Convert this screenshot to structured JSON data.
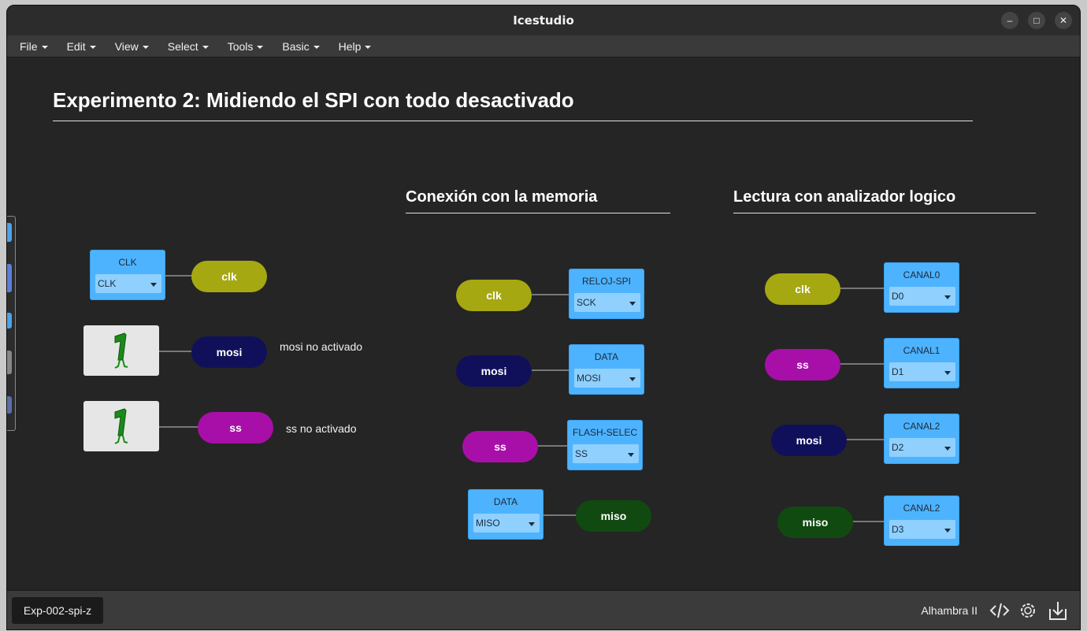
{
  "window": {
    "title": "Icestudio"
  },
  "window_controls": {
    "minimize": "–",
    "maximize": "□",
    "close": "✕"
  },
  "menu": [
    "File",
    "Edit",
    "View",
    "Select",
    "Tools",
    "Basic",
    "Help"
  ],
  "canvas": {
    "main_title": "Experimento 2: Midiendo el SPI con todo desactivado",
    "section_memory": "Conexión con la memoria",
    "section_analyzer": "Lectura con analizador logico",
    "left": {
      "clk_block": {
        "label": "CLK",
        "value": "CLK"
      },
      "clk_pill": "clk",
      "mosi_pill": "mosi",
      "ss_pill": "ss",
      "mosi_note": "mosi no activado",
      "ss_note": "ss no activado"
    },
    "memory": {
      "clk_pill": "clk",
      "mosi_pill": "mosi",
      "ss_pill": "ss",
      "miso_pill": "miso",
      "reloj_block": {
        "label": "RELOJ-SPI",
        "value": "SCK"
      },
      "data_block": {
        "label": "DATA",
        "value": "MOSI"
      },
      "flash_block": {
        "label": "FLASH-SELEC",
        "value": "SS"
      },
      "miso_block": {
        "label": "DATA",
        "value": "MISO"
      }
    },
    "analyzer": {
      "clk_pill": "clk",
      "ss_pill": "ss",
      "mosi_pill": "mosi",
      "miso_pill": "miso",
      "canal0": {
        "label": "CANAL0",
        "value": "D0"
      },
      "canal1": {
        "label": "CANAL1",
        "value": "D1"
      },
      "canal2": {
        "label": "CANAL2",
        "value": "D2"
      },
      "canal3": {
        "label": "CANAL2",
        "value": "D3"
      }
    }
  },
  "colors": {
    "clk": "#a6a812",
    "mosi": "#10105a",
    "ss": "#a80fa8",
    "miso": "#104a10",
    "io_block": "#4db3ff"
  },
  "statusbar": {
    "file_tab": "Exp-002-spi-z",
    "board": "Alhambra II",
    "icons": [
      "code-icon",
      "gear-icon",
      "download-icon"
    ]
  }
}
